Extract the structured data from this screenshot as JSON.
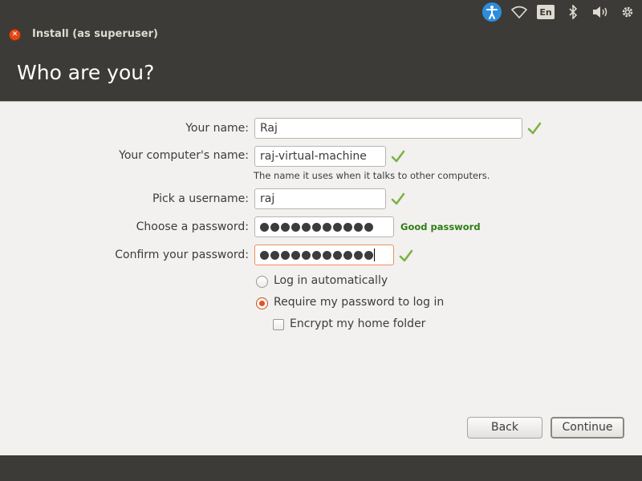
{
  "window": {
    "title": "Install (as superuser)"
  },
  "page": {
    "heading": "Who are you?"
  },
  "indicators": {
    "language": "En"
  },
  "form": {
    "name_label": "Your name:",
    "name_value": "Raj",
    "computer_label": "Your computer's name:",
    "computer_value": "raj-virtual-machine",
    "computer_hint": "The name it uses when it talks to other computers.",
    "username_label": "Pick a username:",
    "username_value": "raj",
    "password_label": "Choose a password:",
    "password_strength": "Good password",
    "confirm_label": "Confirm your password:"
  },
  "password_length": 11,
  "options": {
    "login_auto_label": "Log in automatically",
    "login_auto_selected": false,
    "require_password_label": "Require my password to log in",
    "require_password_selected": true,
    "encrypt_label": "Encrypt my home folder",
    "encrypt_checked": false
  },
  "buttons": {
    "back": "Back",
    "continue": "Continue"
  },
  "colors": {
    "panel": "#3c3b37",
    "accent": "#df4a16",
    "success": "#2e7d16",
    "check": "#7cb342",
    "background": "#f2f1f0"
  }
}
